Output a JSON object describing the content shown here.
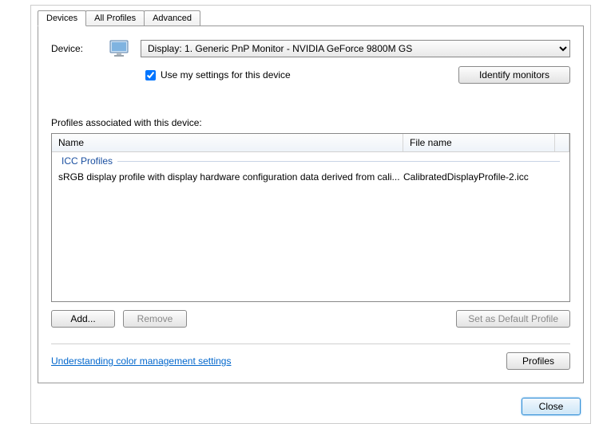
{
  "tabs": {
    "devices": "Devices",
    "all_profiles": "All Profiles",
    "advanced": "Advanced"
  },
  "device": {
    "label": "Device:",
    "selected": "Display: 1. Generic PnP Monitor - NVIDIA GeForce 9800M GS",
    "use_settings_label": "Use my settings for this device",
    "identify_label": "Identify monitors"
  },
  "profiles": {
    "section_label": "Profiles associated with this device:",
    "columns": {
      "name": "Name",
      "file": "File name"
    },
    "group_header": "ICC Profiles",
    "rows": [
      {
        "name": "sRGB display profile with display hardware configuration data derived from cali...",
        "file": "CalibratedDisplayProfile-2.icc"
      }
    ]
  },
  "buttons": {
    "add": "Add...",
    "remove": "Remove",
    "set_default": "Set as Default Profile",
    "profiles": "Profiles",
    "close": "Close"
  },
  "link": "Understanding color management settings"
}
